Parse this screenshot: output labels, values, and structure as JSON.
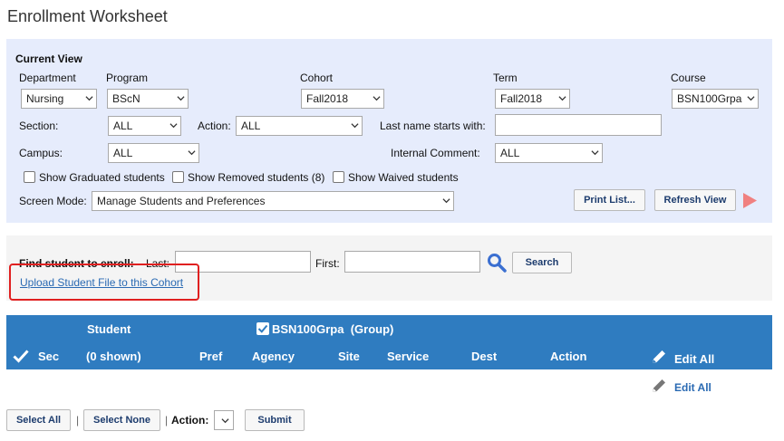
{
  "page": {
    "title": "Enrollment Worksheet"
  },
  "current_view": {
    "heading": "Current View",
    "department": {
      "label": "Department",
      "value": "Nursing"
    },
    "program": {
      "label": "Program",
      "value": "BScN"
    },
    "cohort": {
      "label": "Cohort",
      "value": "Fall2018"
    },
    "term": {
      "label": "Term",
      "value": "Fall2018"
    },
    "course": {
      "label": "Course",
      "value": "BSN100Grpa"
    },
    "section": {
      "label": "Section:",
      "value": "ALL"
    },
    "action": {
      "label": "Action:",
      "value": "ALL"
    },
    "last_name": {
      "label": "Last name starts with:",
      "value": ""
    },
    "campus": {
      "label": "Campus:",
      "value": "ALL"
    },
    "internal_comment": {
      "label": "Internal Comment:",
      "value": "ALL"
    },
    "checkboxes": {
      "graduated": "Show Graduated students",
      "removed": "Show Removed students (8)",
      "waived": "Show Waived students"
    },
    "screen_mode": {
      "label": "Screen Mode:",
      "value": "Manage Students and Preferences"
    },
    "print_list": "Print List...",
    "refresh_view": "Refresh View"
  },
  "find": {
    "label": "Find student to enroll:",
    "last_label": "Last:",
    "first_label": "First:",
    "search_button": "Search",
    "upload_link": "Upload Student File to this Cohort"
  },
  "table": {
    "student_header": "Student",
    "group_header": "BSN100Grpa  (Group)",
    "columns": {
      "sec": "Sec",
      "shown": "(0 shown)",
      "pref": "Pref",
      "agency": "Agency",
      "site": "Site",
      "service": "Service",
      "dest": "Dest",
      "action": "Action"
    },
    "edit_all_header": "Edit All",
    "edit_all_row": "Edit All"
  },
  "footer": {
    "select_all": "Select All",
    "separator": "|",
    "select_none": "Select None",
    "separator2": "|",
    "action_label": "Action:",
    "action_value": "",
    "submit": "Submit"
  },
  "colors": {
    "panel_bg": "#e6ecfc",
    "header_bg": "#2f7cc0",
    "link": "#2a6ab3",
    "highlight_box": "#e02020",
    "play_arrow": "#f08080"
  }
}
